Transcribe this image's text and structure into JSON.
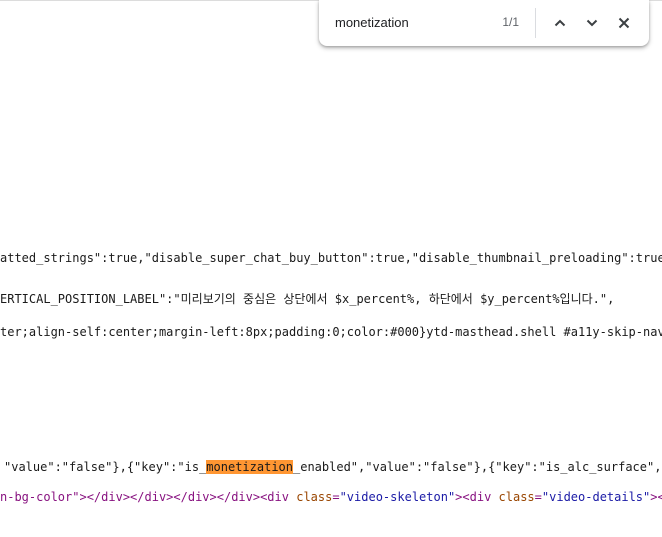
{
  "find_bar": {
    "query": "monetization",
    "count": "1/1",
    "prev_icon": "chevron-up-icon",
    "next_icon": "chevron-down-icon",
    "close_icon": "close-icon"
  },
  "source": {
    "line1": "atted_strings\":true,\"disable_super_chat_buy_button\":true,\"disable_thumbnail_preloading\":true,\"e",
    "line2": "ERTICAL_POSITION_LABEL\":\"미리보기의 중심은 상단에서 $x_percent%, 하단에서 $y_percent%입니다.\",",
    "line3": "ter;align-self:center;margin-left:8px;padding:0;color:#000}ytd-masthead.shell #a11y-skip-nav{di",
    "line4": {
      "before": "\"value\":\"false\"},{\"key\":\"is_",
      "match": "monetization",
      "after": "_enabled\",\"value\":\"false\"},{\"key\":\"is_alc_surface\",\"va"
    },
    "line5": {
      "t1": "n-bg-color\"></div></div></div></div><div ",
      "a1": "class",
      "t2": "=",
      "v1": "\"video-skeleton\"",
      "t3": "><div ",
      "a2": "class",
      "t4": "=",
      "v2": "\"video-details\"",
      "t5": "><di"
    }
  },
  "colors": {
    "match_highlight": "#ff9632",
    "tag": "#881280",
    "attribute": "#994500",
    "attribute_value": "#1a1aa6"
  }
}
